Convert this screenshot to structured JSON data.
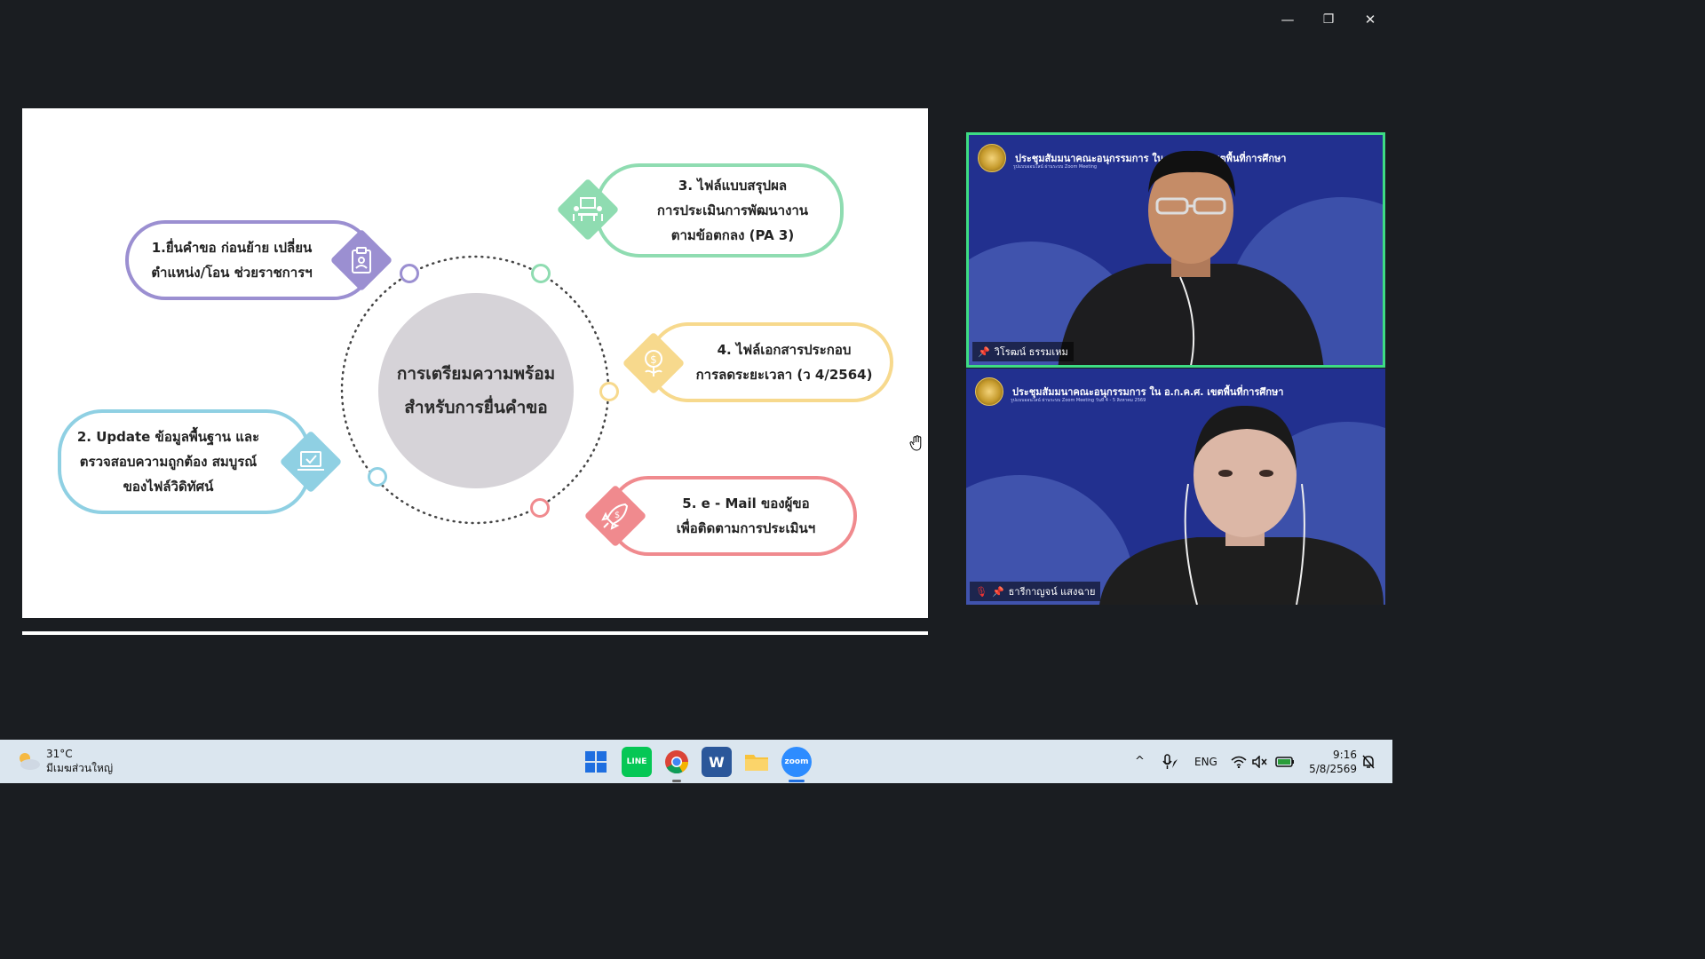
{
  "window": {
    "minimize_icon": "—",
    "restore_icon": "❐",
    "close_icon": "✕"
  },
  "slide": {
    "center_title": "การเตรียมความพร้อม\nสำหรับการยื่นคำขอ",
    "items": [
      {
        "id": "1",
        "text": "1.ยื่นคำขอ ก่อนย้าย เปลี่ยน\nตำแหน่ง/โอน ช่วยราชการฯ",
        "color": "#9b8fd1"
      },
      {
        "id": "2",
        "text": "2. Update ข้อมูลพื้นฐาน และ\nตรวจสอบความถูกต้อง สมบูรณ์\nของไฟล์วิดิทัศน์",
        "color": "#8fd0e3"
      },
      {
        "id": "3",
        "text": "3. ไฟล์แบบสรุปผล\nการประเมินการพัฒนางาน\nตามข้อตกลง (PA 3)",
        "color": "#8fdcb1"
      },
      {
        "id": "4",
        "text": "4. ไฟล์เอกสารประกอบ\nการลดระยะเวลา (ว 4/2564)",
        "color": "#f7d98d"
      },
      {
        "id": "5",
        "text": "5. e - Mail ของผู้ขอ\nเพื่อติดตามการประเมินฯ",
        "color": "#f08a8e"
      }
    ]
  },
  "video": {
    "tiles": [
      {
        "banner": "ประชุมสัมมนาคณะอนุกรรมการ ใน อ.ก.ค.ศ. เขตพื้นที่การศึกษา",
        "sub": "รูปแบบออนไลน์ ผ่านระบบ Zoom Meeting",
        "name": "วิโรฒน์ ธรรมเหม",
        "active": true
      },
      {
        "banner": "ประชุมสัมมนาคณะอนุกรรมการ ใน อ.ก.ค.ศ. เขตพื้นที่การศึกษา",
        "sub": "รูปแบบออนไลน์ ผ่านระบบ Zoom Meeting วันที่ 4 - 5 สิงหาคม 2569",
        "name": "ธารีกาญจน์ แสงฉาย",
        "active": false
      }
    ]
  },
  "taskbar": {
    "weather": {
      "temp": "31°C",
      "desc": "มีเมฆส่วนใหญ่"
    },
    "apps": [
      "start-icon",
      "line-icon",
      "chrome-icon",
      "word-icon",
      "file-explorer-icon",
      "zoom-icon"
    ],
    "line_label": "LINE",
    "word_label": "W",
    "zoom_label": "zoom",
    "lang": "ENG",
    "time": "9:16",
    "date": "5/8/2569",
    "chevron": "^"
  },
  "colors": {
    "background": "#1a1d21",
    "active_speaker": "#3ddc84",
    "tile_bg": "#22308f"
  }
}
